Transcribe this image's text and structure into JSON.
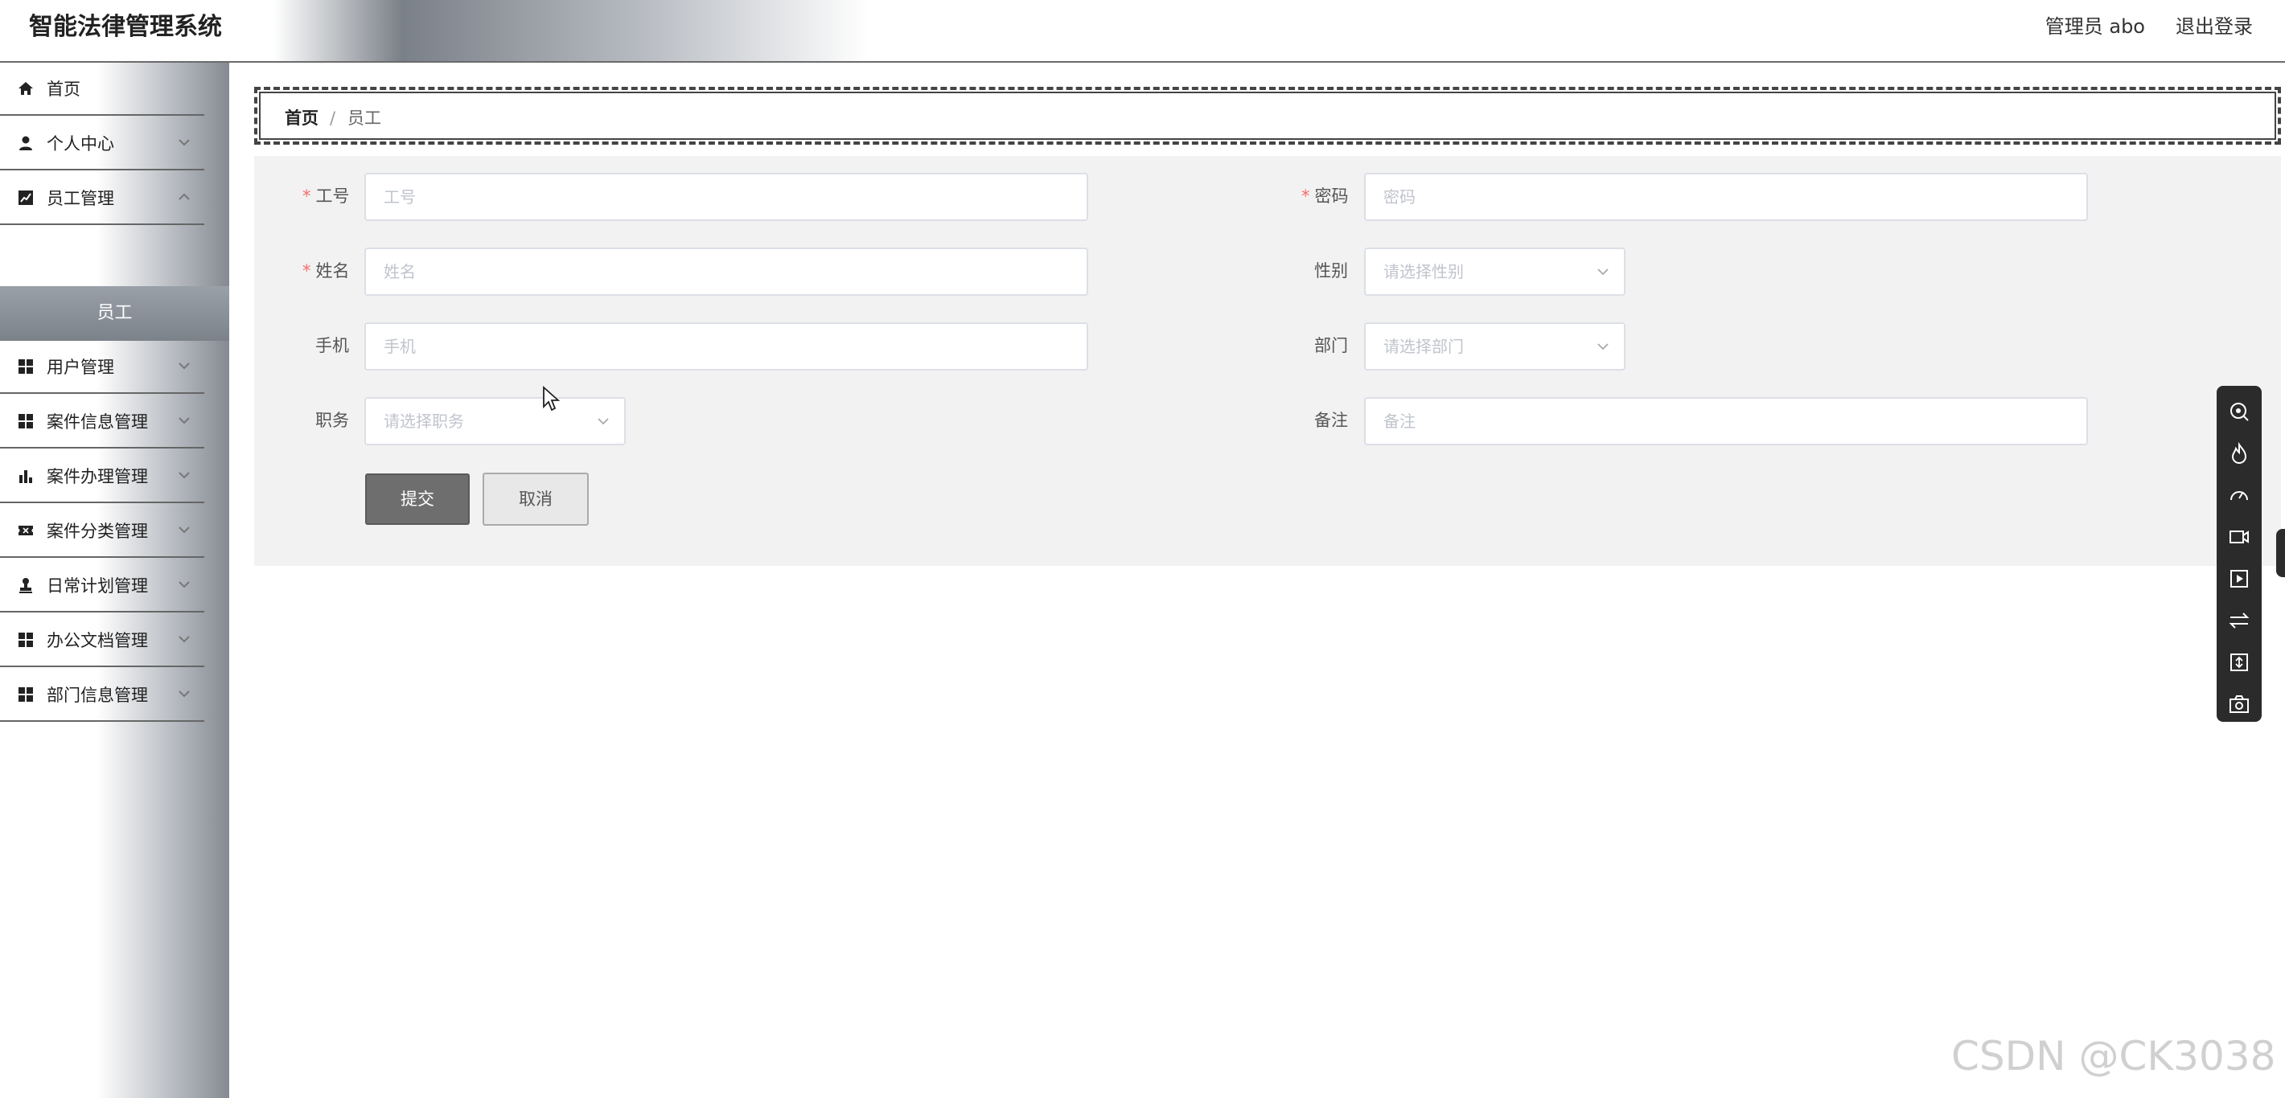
{
  "header": {
    "app_title": "智能法律管理系统",
    "user_label": "管理员 abo",
    "logout_label": "退出登录"
  },
  "sidebar": {
    "items": [
      {
        "label": "首页",
        "icon": "home-icon"
      },
      {
        "label": "个人中心",
        "icon": "user-icon"
      },
      {
        "label": "员工管理",
        "icon": "chart-line-icon"
      },
      {
        "label": "用户管理",
        "icon": "grid-icon"
      },
      {
        "label": "案件信息管理",
        "icon": "grid-icon"
      },
      {
        "label": "案件办理管理",
        "icon": "bar-chart-icon"
      },
      {
        "label": "案件分类管理",
        "icon": "ticket-icon"
      },
      {
        "label": "日常计划管理",
        "icon": "stamp-icon"
      },
      {
        "label": "办公文档管理",
        "icon": "grid-icon"
      },
      {
        "label": "部门信息管理",
        "icon": "grid-icon"
      }
    ],
    "active_sub_item": "员工"
  },
  "breadcrumb": {
    "home": "首页",
    "separator": "/",
    "current": "员工"
  },
  "form": {
    "job_no": {
      "label": "工号",
      "placeholder": "工号",
      "required": true
    },
    "password": {
      "label": "密码",
      "placeholder": "密码",
      "required": true
    },
    "name": {
      "label": "姓名",
      "placeholder": "姓名",
      "required": true
    },
    "gender": {
      "label": "性别",
      "placeholder": "请选择性别"
    },
    "phone": {
      "label": "手机",
      "placeholder": "手机"
    },
    "department": {
      "label": "部门",
      "placeholder": "请选择部门"
    },
    "position": {
      "label": "职务",
      "placeholder": "请选择职务"
    },
    "remark": {
      "label": "备注",
      "placeholder": "备注"
    },
    "required_mark": "*",
    "submit_label": "提交",
    "cancel_label": "取消"
  },
  "toolbar": {
    "tools": [
      "search-target-icon",
      "flame-icon",
      "speed-icon",
      "video-record-icon",
      "play-frame-icon",
      "swap-icon",
      "compress-icon",
      "camera-icon"
    ]
  },
  "watermark": "CSDN @CK3038",
  "colors": {
    "required": "#f56c6c",
    "submit_bg": "#6e6e6e",
    "toolbar_bg": "#2b2b2b"
  }
}
